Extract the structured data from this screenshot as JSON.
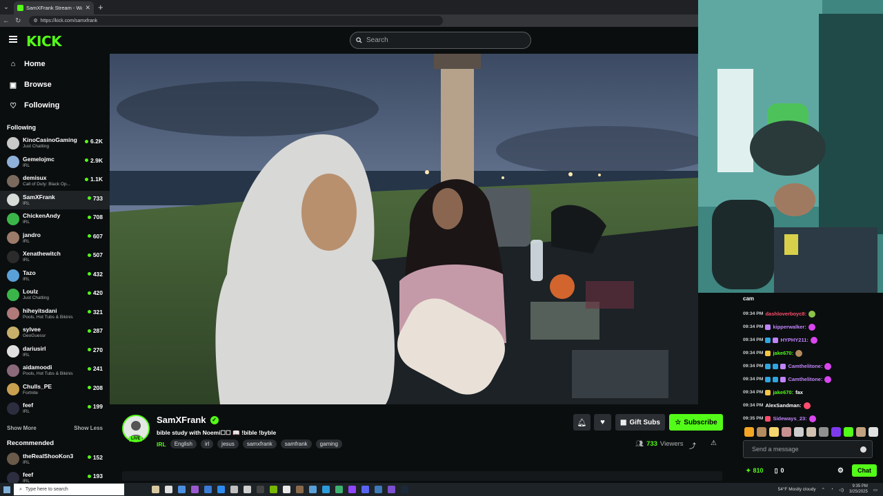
{
  "browser": {
    "tab_title": "SamXFrank Stream - Watch Live o",
    "url": "https://kick.com/samxfrank"
  },
  "header": {
    "logo": "KICK",
    "search_placeholder": "Search"
  },
  "sidebar": {
    "nav": [
      {
        "label": "Home",
        "icon": "home-icon"
      },
      {
        "label": "Browse",
        "icon": "browse-icon"
      },
      {
        "label": "Following",
        "icon": "heart-icon"
      }
    ],
    "following_title": "Following",
    "following": [
      {
        "name": "KinoCasinoGaming",
        "category": "Just Chatting",
        "viewers": "6.2K",
        "color": "#c9c9c9"
      },
      {
        "name": "Gemelojmc",
        "category": "IRL",
        "viewers": "2.9K",
        "color": "#8fb0d8"
      },
      {
        "name": "demisux",
        "category": "Call of Duty: Black Op...",
        "viewers": "1.1K",
        "color": "#7a6a5e"
      },
      {
        "name": "SamXFrank",
        "category": "IRL",
        "viewers": "733",
        "color": "#d8dcd8"
      },
      {
        "name": "ChickenAndy",
        "category": "IRL",
        "viewers": "708",
        "color": "#3bb54a"
      },
      {
        "name": "jandro",
        "category": "IRL",
        "viewers": "607",
        "color": "#9d7b6a"
      },
      {
        "name": "Xenathewitch",
        "category": "IRL",
        "viewers": "507",
        "color": "#2b2b2b"
      },
      {
        "name": "Tazo",
        "category": "IRL",
        "viewers": "432",
        "color": "#5aa0d8"
      },
      {
        "name": "Loulz",
        "category": "Just Chatting",
        "viewers": "420",
        "color": "#3bb54a"
      },
      {
        "name": "hiheyitsdani",
        "category": "Pools, Hot Tubs & Bikinis",
        "viewers": "321",
        "color": "#b07a7a"
      },
      {
        "name": "sylvee",
        "category": "GeoGuessr",
        "viewers": "287",
        "color": "#c8b06a"
      },
      {
        "name": "dariusirl",
        "category": "IRL",
        "viewers": "270",
        "color": "#e0e0e0"
      },
      {
        "name": "aidamoodi",
        "category": "Pools, Hot Tubs & Bikinis",
        "viewers": "241",
        "color": "#8a6a7a"
      },
      {
        "name": "Chulls_PE",
        "category": "Fortnite",
        "viewers": "208",
        "color": "#c8a050"
      },
      {
        "name": "feef",
        "category": "IRL",
        "viewers": "199",
        "color": "#2d2d40"
      }
    ],
    "show_more": "Show More",
    "show_less": "Show Less",
    "recommended_title": "Recommended",
    "recommended": [
      {
        "name": "theRealShooKon3",
        "category": "IRL",
        "viewers": "152",
        "color": "#6a5a4a"
      },
      {
        "name": "feef",
        "category": "IRL",
        "viewers": "193",
        "color": "#2d2d40"
      }
    ]
  },
  "channel": {
    "name": "SamXFrank",
    "live_badge": "LIVE",
    "stream_title": "bible study with Noemi☐☐ 📖 !bible !byble",
    "category": "IRL",
    "tags": [
      "English",
      "irl",
      "jesus",
      "samxfrank",
      "samfrank",
      "gaming"
    ],
    "gift_label": "Gift Subs",
    "subscribe_label": "Subscribe",
    "viewers": "733",
    "viewers_label": "Viewers"
  },
  "chat": {
    "title": "cam",
    "messages": [
      {
        "time": "09:34 PM",
        "user": "dashloverboyc8:",
        "color": "#ff4d6d",
        "badges": [],
        "text": "",
        "emote": "#8bc34a"
      },
      {
        "time": "09:34 PM",
        "user": "kipperwalker:",
        "color": "#c084fc",
        "badges": [
          "#c084fc"
        ],
        "text": "",
        "emote": "#d946ef"
      },
      {
        "time": "09:34 PM",
        "user": "HYPHY211:",
        "color": "#c084fc",
        "badges": [
          "#2fa6e0",
          "#c084fc"
        ],
        "text": "",
        "emote": "#d946ef"
      },
      {
        "time": "09:34 PM",
        "user": "jake670:",
        "color": "#53fc18",
        "badges": [
          "#f5c542"
        ],
        "text": "",
        "emote": "#b38b5d"
      },
      {
        "time": "09:34 PM",
        "user": "Camthelitone:",
        "color": "#c084fc",
        "badges": [
          "#2fa6e0",
          "#2fa6e0",
          "#c084fc"
        ],
        "text": "",
        "emote": "#d946ef"
      },
      {
        "time": "09:34 PM",
        "user": "Camthelitone:",
        "color": "#c084fc",
        "badges": [
          "#2fa6e0",
          "#2fa6e0",
          "#c084fc"
        ],
        "text": "",
        "emote": "#d946ef"
      },
      {
        "time": "09:34 PM",
        "user": "jake670:",
        "color": "#53fc18",
        "badges": [
          "#f5c542"
        ],
        "text": "fax",
        "emote": ""
      },
      {
        "time": "09:34 PM",
        "user": "AlexSandman:",
        "color": "#ffffff",
        "badges": [],
        "text": "",
        "emote": "#ff4d6d"
      },
      {
        "time": "09:35 PM",
        "user": "Sideways_23:",
        "color": "#c084fc",
        "badges": [
          "#ff4d6d"
        ],
        "text": "",
        "emote": "#d946ef"
      }
    ],
    "emote_colors": [
      "#f5a623",
      "#b38b5d",
      "#f5d76e",
      "#c89090",
      "#cccccc",
      "#d0c0b0",
      "#909090",
      "#7c3aed",
      "#53fc18",
      "#c0a080",
      "#e0e0e0"
    ],
    "input_placeholder": "Send a message",
    "points": "810",
    "tickets": "0",
    "chat_button": "Chat"
  },
  "taskbar": {
    "search_placeholder": "Type here to search",
    "weather": "54°F  Mostly cloudy",
    "time": "9:35 PM",
    "date": "3/25/2025"
  }
}
